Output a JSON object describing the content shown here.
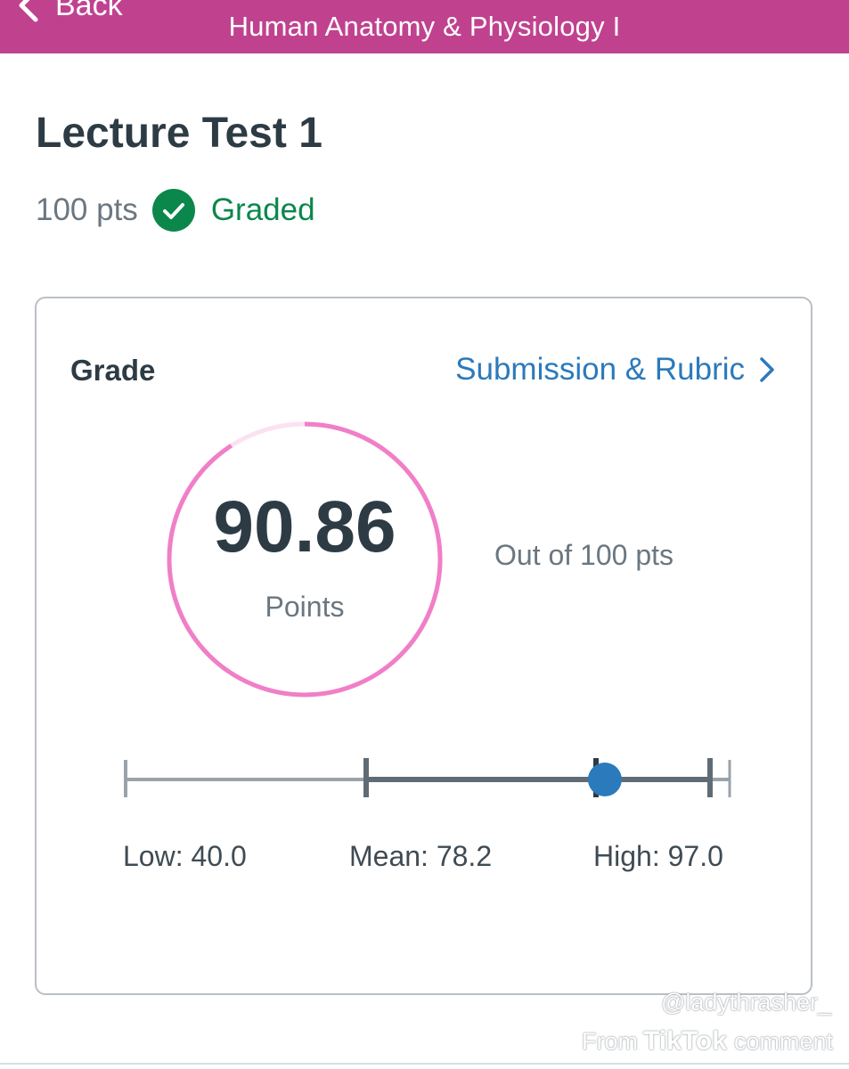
{
  "nav": {
    "back_label": "Back",
    "course_name": "Human Anatomy & Physiology I",
    "color": "#c0428f"
  },
  "assignment": {
    "title": "Lecture Test 1",
    "points_possible": "100 pts",
    "status": "Graded",
    "status_icon": "check-circle-icon",
    "status_color": "#0b874b"
  },
  "grade_card": {
    "label": "Grade",
    "link_label": "Submission & Rubric",
    "score": "90.86",
    "score_unit": "Points",
    "out_of": "Out of 100 pts",
    "score_fraction": 0.9086,
    "ring_color": "#f07fc7",
    "ring_track_color": "#fbe2f1"
  },
  "statistics": {
    "low_label": "Low: 40.0",
    "mean_label": "Mean: 78.2",
    "high_label": "High: 97.0",
    "low": 40.0,
    "mean": 78.2,
    "high": 97.0,
    "score": 90.86,
    "max": 100,
    "marker_color": "#2b7abc"
  },
  "watermark": {
    "handle": "@ladythrasher_",
    "from_label": "From",
    "brand": "TikTok",
    "comment_label": "comment"
  }
}
